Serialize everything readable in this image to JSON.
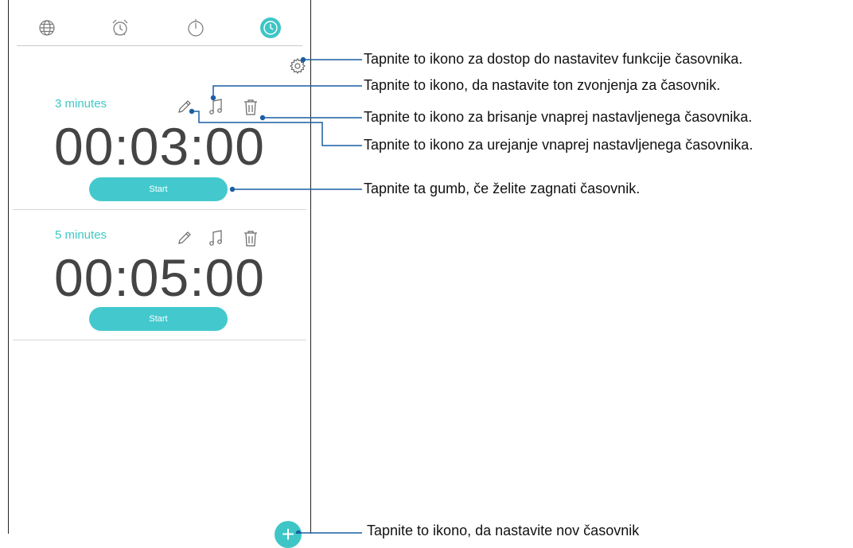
{
  "tabs": {
    "world_clock": "globe-icon",
    "alarm": "alarm-clock-icon",
    "stopwatch": "stopwatch-icon",
    "timer": "timer-icon"
  },
  "settings_icon": "gear-icon",
  "timers": [
    {
      "label": "3 minutes",
      "time": "00:03:00",
      "start_label": "Start"
    },
    {
      "label": "5 minutes",
      "time": "00:05:00",
      "start_label": "Start"
    }
  ],
  "add_button": {
    "icon": "plus-icon",
    "symbol": "+"
  },
  "callouts": [
    "Tapnite to ikono za dostop do nastavitev funkcije časovnika.",
    "Tapnite to ikono, da nastavite ton zvonjenja za časovnik.",
    "Tapnite to ikono za brisanje vnaprej nastavljenega časovnika.",
    "Tapnite to ikono za urejanje vnaprej nastavljenega časovnika.",
    "Tapnite ta gumb, če želite zagnati časovnik.",
    "Tapnite to ikono, da nastavite nov časovnik"
  ],
  "colors": {
    "accent": "#43c9cd",
    "text": "#444444",
    "icon": "#777777"
  }
}
